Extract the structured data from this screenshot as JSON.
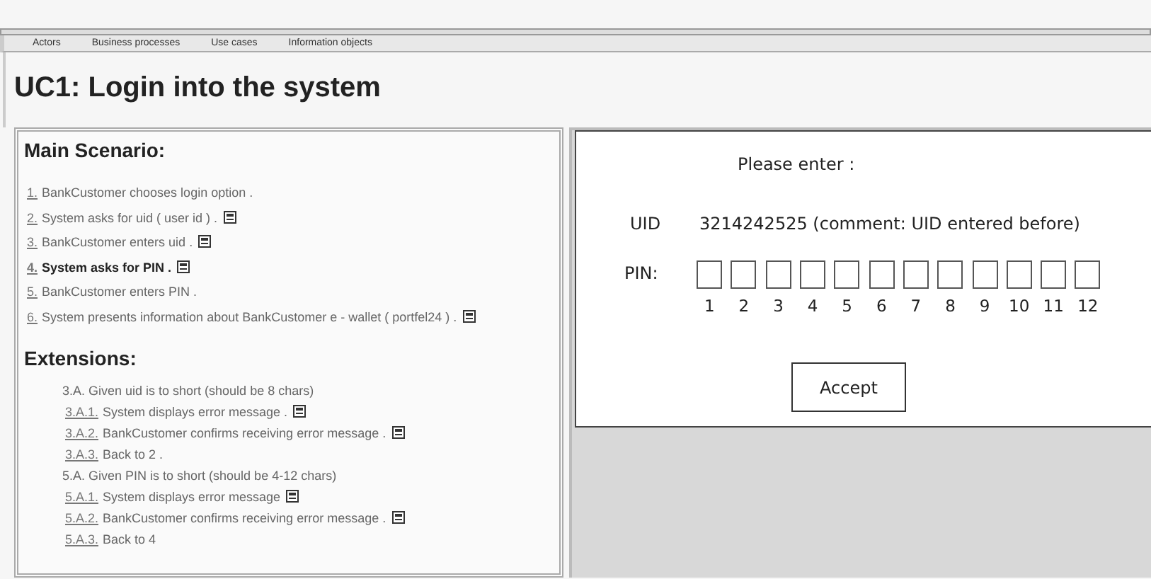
{
  "tabs": [
    {
      "label": "Actors"
    },
    {
      "label": "Business processes"
    },
    {
      "label": "Use cases"
    },
    {
      "label": "Information objects"
    }
  ],
  "title": "UC1: Login into the system",
  "main_scenario": {
    "heading": "Main Scenario:",
    "steps": [
      {
        "number": "1.",
        "text": "BankCustomer chooses login option .",
        "note": false,
        "current": false
      },
      {
        "number": "2.",
        "text": "System asks for uid ( user id ) .",
        "note": true,
        "current": false
      },
      {
        "number": "3.",
        "text": "BankCustomer enters uid .",
        "note": true,
        "current": false
      },
      {
        "number": "4.",
        "text": "System asks for PIN .",
        "note": true,
        "current": true
      },
      {
        "number": "5.",
        "text": "BankCustomer enters PIN .",
        "note": false,
        "current": false
      },
      {
        "number": "6.",
        "text": "System presents information about BankCustomer e - wallet ( portfel24 ) .",
        "note": true,
        "current": false
      }
    ]
  },
  "extensions": {
    "heading": "Extensions:",
    "items": [
      {
        "kind": "condition",
        "text": "3.A. Given uid is to short (should be 8 chars)"
      },
      {
        "kind": "step",
        "number": "3.A.1.",
        "text": "System displays error message .",
        "note": true
      },
      {
        "kind": "step",
        "number": "3.A.2.",
        "text": "BankCustomer confirms receiving error message .",
        "note": true
      },
      {
        "kind": "step",
        "number": "3.A.3.",
        "text": "Back to 2 .",
        "note": false
      },
      {
        "kind": "condition",
        "text": "5.A. Given PIN is to short (should be 4-12 chars)"
      },
      {
        "kind": "step",
        "number": "5.A.1.",
        "text": "System displays error message",
        "note": true
      },
      {
        "kind": "step",
        "number": "5.A.2.",
        "text": "BankCustomer confirms receiving error message .",
        "note": true
      },
      {
        "kind": "step",
        "number": "5.A.3.",
        "text": "Back to 4",
        "note": false
      }
    ]
  },
  "mockup": {
    "prompt": "Please enter :",
    "uid_label": "UID",
    "uid_value": "3214242525 (comment: UID entered before)",
    "pin_label": "PIN:",
    "pin_digits": [
      "1",
      "2",
      "3",
      "4",
      "5",
      "6",
      "7",
      "8",
      "9",
      "10",
      "11",
      "12"
    ],
    "accept": "Accept"
  }
}
